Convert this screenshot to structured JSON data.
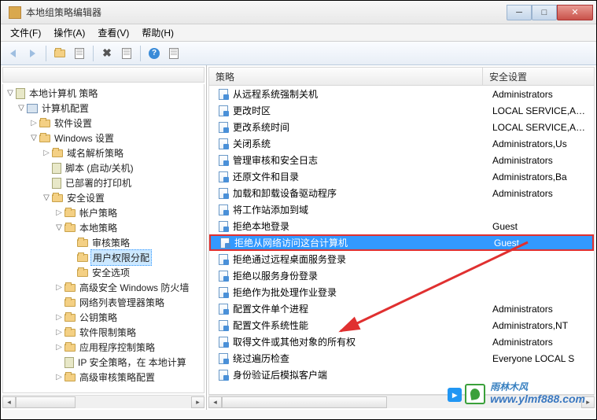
{
  "window": {
    "title": "本地组策略编辑器"
  },
  "menu": {
    "file": "文件(F)",
    "action": "操作(A)",
    "view": "查看(V)",
    "help": "帮助(H)"
  },
  "tree": {
    "root": "本地计算机 策略",
    "computer_config": "计算机配置",
    "software_settings": "软件设置",
    "windows_settings": "Windows 设置",
    "dns_policy": "域名解析策略",
    "scripts": "脚本 (启动/关机)",
    "deployed_printers": "已部署的打印机",
    "security_settings": "安全设置",
    "account_policies": "帐户策略",
    "local_policies": "本地策略",
    "audit_policy": "审核策略",
    "user_rights": "用户权限分配",
    "security_options": "安全选项",
    "adv_firewall": "高级安全 Windows 防火墙",
    "network_list": "网络列表管理器策略",
    "public_key": "公钥策略",
    "software_restrict": "软件限制策略",
    "app_control": "应用程序控制策略",
    "ip_security": "IP 安全策略，在 本地计算",
    "adv_audit": "高级审核策略配置"
  },
  "list": {
    "header_policy": "策略",
    "header_security": "安全设置",
    "rows": [
      {
        "policy": "从远程系统强制关机",
        "setting": "Administrators"
      },
      {
        "policy": "更改时区",
        "setting": "LOCAL SERVICE,A…"
      },
      {
        "policy": "更改系统时间",
        "setting": "LOCAL SERVICE,A…"
      },
      {
        "policy": "关闭系统",
        "setting": "Administrators,Us"
      },
      {
        "policy": "管理审核和安全日志",
        "setting": "Administrators"
      },
      {
        "policy": "还原文件和目录",
        "setting": "Administrators,Ba"
      },
      {
        "policy": "加载和卸载设备驱动程序",
        "setting": "Administrators"
      },
      {
        "policy": "将工作站添加到域",
        "setting": ""
      },
      {
        "policy": "拒绝本地登录",
        "setting": "Guest"
      },
      {
        "policy": "拒绝从网络访问这台计算机",
        "setting": "Guest",
        "selected": true
      },
      {
        "policy": "拒绝通过远程桌面服务登录",
        "setting": ""
      },
      {
        "policy": "拒绝以服务身份登录",
        "setting": ""
      },
      {
        "policy": "拒绝作为批处理作业登录",
        "setting": ""
      },
      {
        "policy": "配置文件单个进程",
        "setting": "Administrators"
      },
      {
        "policy": "配置文件系统性能",
        "setting": "Administrators,NT"
      },
      {
        "policy": "取得文件或其他对象的所有权",
        "setting": "Administrators"
      },
      {
        "policy": "绕过遍历检查",
        "setting": "Everyone LOCAL S"
      },
      {
        "policy": "身份验证后模拟客户端",
        "setting": ""
      }
    ]
  },
  "watermark": {
    "brand": "雨林木风",
    "url": "www.ylmf888.com"
  }
}
